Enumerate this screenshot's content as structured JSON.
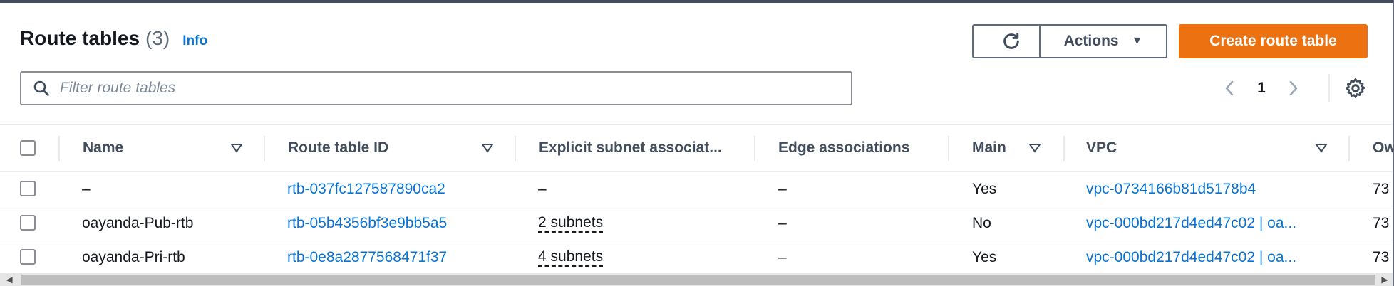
{
  "header": {
    "title": "Route tables",
    "count": "(3)",
    "info_link": "Info"
  },
  "toolbar": {
    "refresh_icon": "refresh-icon",
    "actions_label": "Actions",
    "create_label": "Create route table"
  },
  "filter": {
    "placeholder": "Filter route tables",
    "value": ""
  },
  "pagination": {
    "current_page": "1"
  },
  "table": {
    "columns": [
      "Name",
      "Route table ID",
      "Explicit subnet associat...",
      "Edge associations",
      "Main",
      "VPC",
      "Ow"
    ],
    "rows": [
      {
        "name": "–",
        "route_table_id": "rtb-037fc127587890ca2",
        "explicit_subnet": "–",
        "edge": "–",
        "main": "Yes",
        "vpc": "vpc-0734166b81d5178b4",
        "owner": "73"
      },
      {
        "name": "oayanda-Pub-rtb",
        "route_table_id": "rtb-05b4356bf3e9bb5a5",
        "explicit_subnet": "2 subnets",
        "edge": "–",
        "main": "No",
        "vpc": "vpc-000bd217d4ed47c02 | oa...",
        "owner": "73"
      },
      {
        "name": "oayanda-Pri-rtb",
        "route_table_id": "rtb-0e8a2877568471f37",
        "explicit_subnet": "4 subnets",
        "edge": "–",
        "main": "Yes",
        "vpc": "vpc-000bd217d4ed47c02 | oa...",
        "owner": "73"
      }
    ]
  },
  "colors": {
    "primary": "#ec7211",
    "link": "#0972d3",
    "text": "#16191f",
    "muted": "#5f6b7a"
  }
}
